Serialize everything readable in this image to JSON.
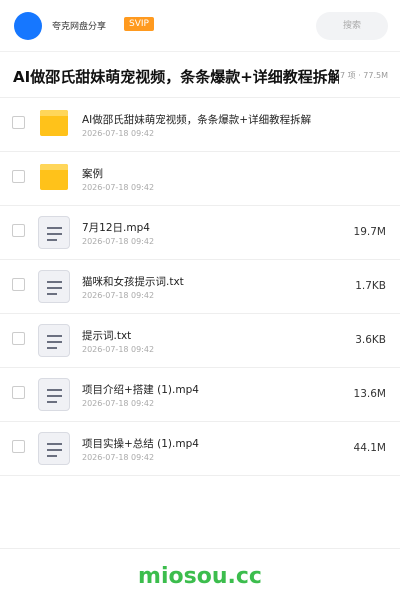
{
  "header": {
    "username": "夸克网盘分享",
    "badge": "SVIP",
    "search_placeholder": "搜索"
  },
  "title_bar": {
    "title": "AI做邵氏甜妹萌宠视频，条条爆款+详细教程拆解",
    "meta": "7 项 · 77.5M"
  },
  "files": [
    {
      "type": "folder",
      "name": "AI做邵氏甜妹萌宠视频，条条爆款+详细教程拆解",
      "date": "2026-07-18 09:42",
      "size": ""
    },
    {
      "type": "folder",
      "name": "案例",
      "date": "2026-07-18 09:42",
      "size": ""
    },
    {
      "type": "file",
      "name": "7月12日.mp4",
      "date": "2026-07-18 09:42",
      "size": "19.7M"
    },
    {
      "type": "file",
      "name": "猫咪和女孩提示词.txt",
      "date": "2026-07-18 09:42",
      "size": "1.7KB"
    },
    {
      "type": "file",
      "name": "提示词.txt",
      "date": "2026-07-18 09:42",
      "size": "3.6KB"
    },
    {
      "type": "file",
      "name": "项目介绍+搭建 (1).mp4",
      "date": "2026-07-18 09:42",
      "size": "13.6M"
    },
    {
      "type": "file",
      "name": "项目实操+总结 (1).mp4",
      "date": "2026-07-18 09:42",
      "size": "44.1M"
    }
  ],
  "footer": {
    "watermark": "miosou.cc"
  },
  "colors": {
    "accent": "#1677ff",
    "badge": "#ff9a1f",
    "folder": "#ffc21a",
    "watermark": "#3cbd4d"
  }
}
